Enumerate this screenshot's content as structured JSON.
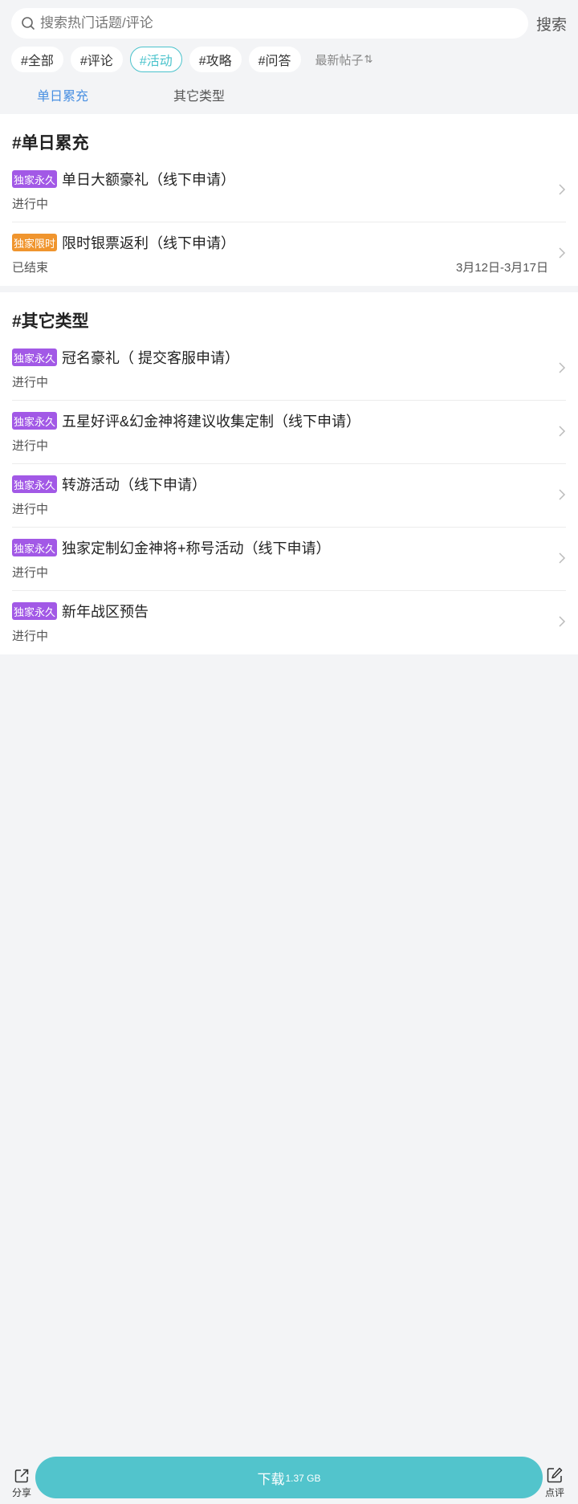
{
  "search": {
    "placeholder": "搜索热门话题/评论",
    "button_label": "搜索"
  },
  "filters": {
    "tags": [
      {
        "label": "#全部",
        "active": false
      },
      {
        "label": "#评论",
        "active": false
      },
      {
        "label": "#活动",
        "active": true
      },
      {
        "label": "#攻略",
        "active": false
      },
      {
        "label": "#问答",
        "active": false
      }
    ],
    "sort_label": "最新帖子",
    "sort_icon": "⇅"
  },
  "subtabs": [
    {
      "label": "单日累充",
      "active": true
    },
    {
      "label": "其它类型",
      "active": false
    }
  ],
  "sections": [
    {
      "title": "#单日累充",
      "items": [
        {
          "badge": "独家永久",
          "badge_color": "#a259e6",
          "title": "单日大额豪礼（线下申请）",
          "status": "进行中",
          "date": ""
        },
        {
          "badge": "独家限时",
          "badge_color": "#f0952e",
          "title": "限时银票返利（线下申请）",
          "status": "已结束",
          "date": "3月12日-3月17日"
        }
      ]
    },
    {
      "title": "#其它类型",
      "items": [
        {
          "badge": "独家永久",
          "badge_color": "#a259e6",
          "title": "冠名豪礼（ 提交客服申请）",
          "status": "进行中",
          "date": ""
        },
        {
          "badge": "独家永久",
          "badge_color": "#a259e6",
          "title": "五星好评&幻金神将建议收集定制（线下申请）",
          "status": "进行中",
          "date": ""
        },
        {
          "badge": "独家永久",
          "badge_color": "#a259e6",
          "title": "转游活动（线下申请）",
          "status": "进行中",
          "date": ""
        },
        {
          "badge": "独家永久",
          "badge_color": "#a259e6",
          "title": "独家定制幻金神将+称号活动（线下申请）",
          "status": "进行中",
          "date": ""
        },
        {
          "badge": "独家永久",
          "badge_color": "#a259e6",
          "title": "新年战区预告",
          "status": "进行中",
          "date": ""
        }
      ]
    }
  ],
  "bottom": {
    "share_label": "分享",
    "download_label": "下载",
    "download_size": "1.37 GB",
    "review_label": "点评",
    "download_color": "#52c4cc"
  }
}
